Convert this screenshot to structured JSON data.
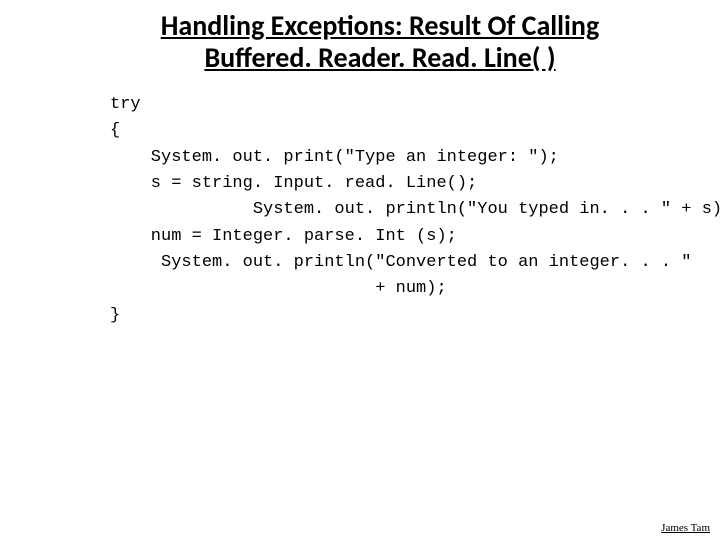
{
  "title_line1": "Handling Exceptions: Result Of Calling",
  "title_line2": "Buffered. Reader. Read. Line( )",
  "code": {
    "l1": "try",
    "l2": "{",
    "l3": "    System. out. print(\"Type an integer: \");",
    "l4": "    s = string. Input. read. Line();",
    "l5": "              System. out. println(\"You typed in. . . \" + s);",
    "l6": "    num = Integer. parse. Int (s);",
    "l7": "     System. out. println(\"Converted to an integer. . . \"",
    "l8": "                          + num);",
    "l9": "}"
  },
  "footer": "James Tam"
}
